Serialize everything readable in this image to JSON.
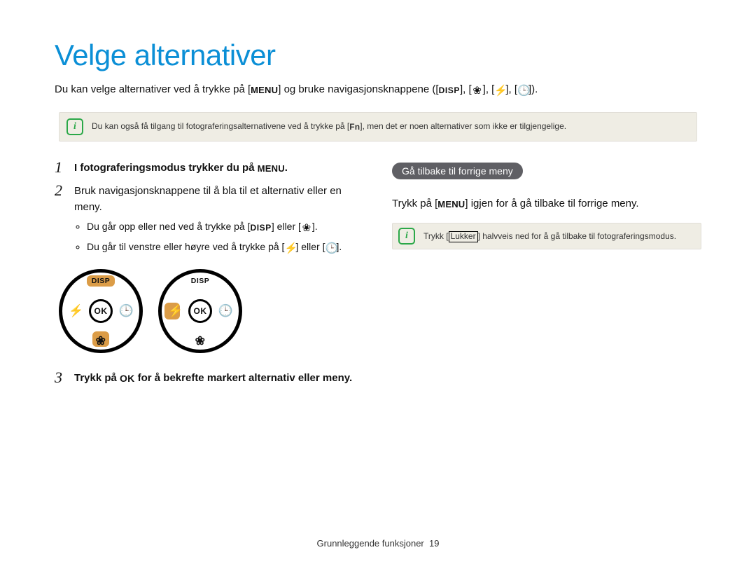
{
  "title": "Velge alternativer",
  "intro": {
    "part1": "Du kan velge alternativer ved å trykke på [",
    "menu": "MENU",
    "part2": "] og bruke navigasjonsknappene ([",
    "disp": "DISP",
    "sep": "], [",
    "part3": "])."
  },
  "note1": {
    "part1": "Du kan også få tilgang til fotograferingsalternativene ved å trykke på [",
    "fn": "Fn",
    "part2": "], men det er noen alternativer som ikke er tilgjengelige."
  },
  "steps": {
    "s1": {
      "num": "1",
      "text_a": "I fotograferingsmodus trykker du på",
      "menu": "MENU",
      "text_b": "."
    },
    "s2": {
      "num": "2",
      "heading": "Bruk navigasjonsknappene til å bla til et alternativ eller en meny.",
      "b1_a": "Du går opp eller ned ved å trykke på [",
      "disp": "DISP",
      "b1_b": "] eller [",
      "b1_c": "].",
      "b2_a": "Du går til venstre eller høyre ved å trykke på [",
      "b2_b": "] eller [",
      "b2_c": "]."
    },
    "s3": {
      "num": "3",
      "text_a": "Trykk på ",
      "ok": "OK",
      "text_b": " for å bekrefte markert alternativ eller meny."
    }
  },
  "dial": {
    "top": "DISP",
    "ok": "OK",
    "macro": "❀",
    "flash": "⚡",
    "timer": "🕒"
  },
  "right": {
    "pill": "Gå tilbake til forrige meny",
    "para_a": "Trykk på [",
    "menu": "MENU",
    "para_b": "] igjen for å gå tilbake til forrige meny.",
    "note2_a": "Trykk [",
    "note2_key": "Lukker",
    "note2_b": "] halvveis ned for å gå tilbake til fotograferingsmodus."
  },
  "footer": {
    "section": "Grunnleggende funksjoner",
    "page": "19"
  }
}
